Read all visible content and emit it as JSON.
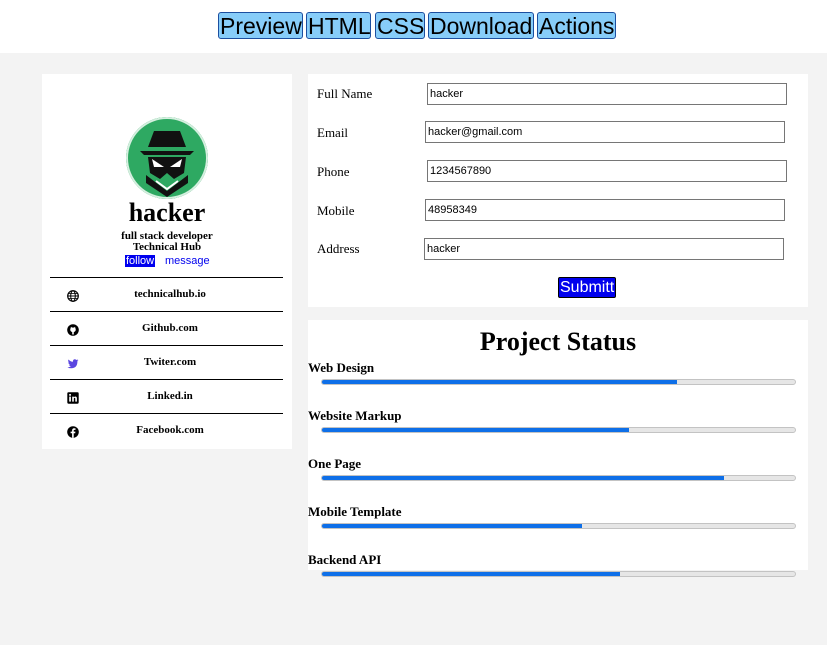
{
  "toolbar": {
    "buttons": [
      "Preview",
      "HTML",
      "CSS",
      "Download",
      "Actions"
    ]
  },
  "profile": {
    "username": "hacker",
    "role": "full stack developer",
    "org": "Technical Hub",
    "follow_label": "follow",
    "message_label": "message",
    "avatar_color": "#2ea962",
    "links": [
      {
        "icon": "globe-icon",
        "label": "technicalhub.io",
        "color": "#000000"
      },
      {
        "icon": "github-icon",
        "label": "Github.com",
        "color": "#000000"
      },
      {
        "icon": "twitter-icon",
        "label": "Twiter.com",
        "color": "#5b46e0"
      },
      {
        "icon": "linkedin-icon",
        "label": "Linked.in",
        "color": "#000000"
      },
      {
        "icon": "facebook-icon",
        "label": "Facebook.com",
        "color": "#000000"
      }
    ]
  },
  "form": {
    "fields": [
      {
        "label": "Full Name",
        "value": "hacker"
      },
      {
        "label": "Email",
        "value": "hacker@gmail.com"
      },
      {
        "label": "Phone",
        "value": "1234567890"
      },
      {
        "label": "Mobile",
        "value": "48958349"
      },
      {
        "label": "Address",
        "value": "hacker"
      }
    ],
    "submit_label": "Submitt"
  },
  "project_status": {
    "title": "Project Status",
    "accent_color": "#0e6fe8",
    "items": [
      {
        "label": "Web Design",
        "progress": 0.75
      },
      {
        "label": "Website Markup",
        "progress": 0.65
      },
      {
        "label": "One Page",
        "progress": 0.85
      },
      {
        "label": "Mobile Template",
        "progress": 0.55
      },
      {
        "label": "Backend API",
        "progress": 0.63
      }
    ]
  }
}
